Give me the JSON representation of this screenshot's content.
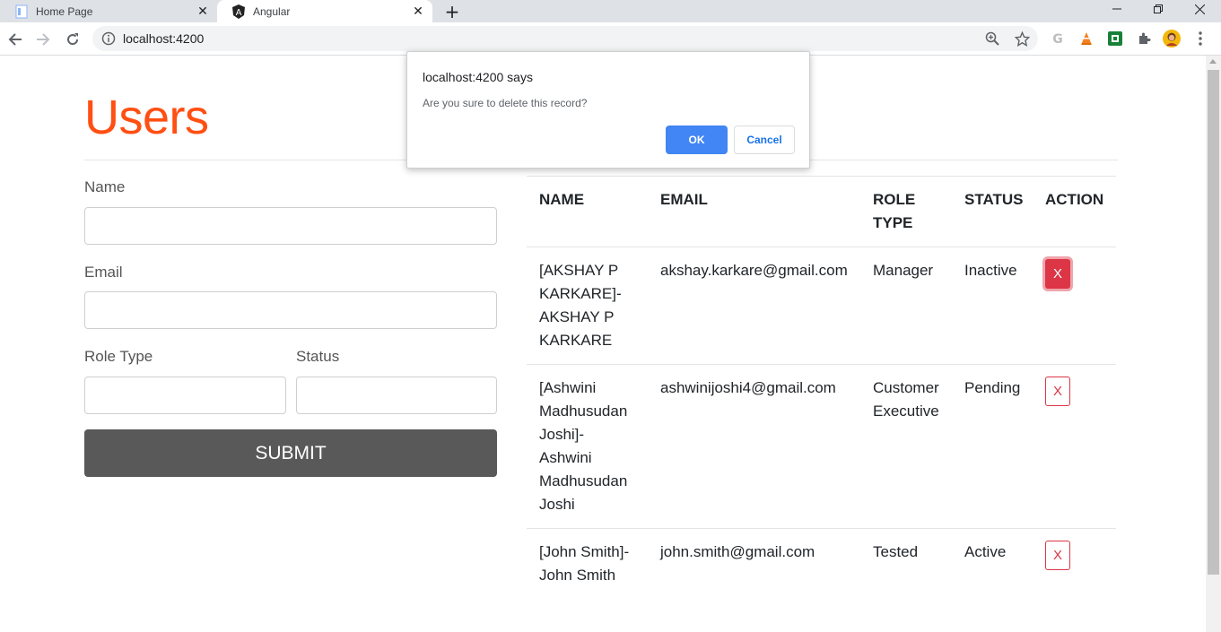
{
  "browser": {
    "tabs": [
      {
        "title": "Home Page",
        "active": false
      },
      {
        "title": "Angular",
        "active": true
      }
    ],
    "url": "localhost:4200"
  },
  "page": {
    "heading": "Users",
    "form": {
      "name_label": "Name",
      "name_value": "",
      "email_label": "Email",
      "email_value": "",
      "role_label": "Role Type",
      "role_value": "",
      "status_label": "Status",
      "status_value": "",
      "submit_label": "SUBMIT"
    },
    "table": {
      "headers": {
        "name": "NAME",
        "email": "EMAIL",
        "role_line1": "ROLE",
        "role_line2": "TYPE",
        "status": "STATUS",
        "action": "ACTION"
      },
      "rows": [
        {
          "name_lines": [
            "[AKSHAY P",
            "KARKARE]-",
            "AKSHAY P",
            "KARKARE"
          ],
          "email": "akshay.karkare@gmail.com",
          "role_lines": [
            "Manager"
          ],
          "status": "Inactive",
          "action": "X"
        },
        {
          "name_lines": [
            "[Ashwini",
            "Madhusudan",
            "Joshi]-",
            "Ashwini",
            "Madhusudan",
            "Joshi"
          ],
          "email": "ashwinijoshi4@gmail.com",
          "role_lines": [
            "Customer",
            "Executive"
          ],
          "status": "Pending",
          "action": "X"
        },
        {
          "name_lines": [
            "[John Smith]-",
            "John Smith"
          ],
          "email": "john.smith@gmail.com",
          "role_lines": [
            "Tested"
          ],
          "status": "Active",
          "action": "X"
        }
      ]
    }
  },
  "dialog": {
    "title": "localhost:4200 says",
    "message": "Are you sure to delete this record?",
    "ok_label": "OK",
    "cancel_label": "Cancel"
  },
  "colors": {
    "heading": "#ff4f12",
    "submit_bg": "#595959",
    "danger": "#dc3545",
    "dialog_ok": "#4285f4"
  }
}
